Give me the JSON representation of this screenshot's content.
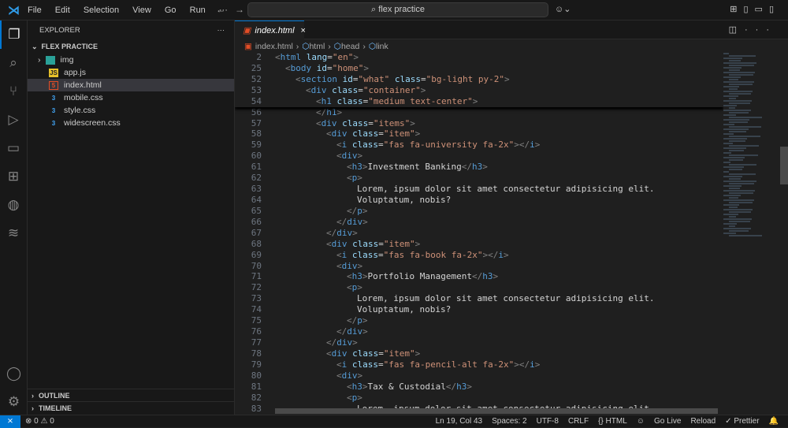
{
  "titlebar": {
    "menu": [
      "File",
      "Edit",
      "Selection",
      "View",
      "Go",
      "Run",
      "···"
    ],
    "search": "⌕ flex practice"
  },
  "sidebar": {
    "title": "EXPLORER",
    "more": "···",
    "folder": "FLEX PRACTICE",
    "files": [
      {
        "name": "img",
        "type": "folder",
        "icon": "image-folder-icon"
      },
      {
        "name": "app.js",
        "type": "js",
        "icon": "js-file-icon"
      },
      {
        "name": "index.html",
        "type": "html",
        "icon": "html-file-icon",
        "selected": true
      },
      {
        "name": "mobile.css",
        "type": "css",
        "icon": "css-file-icon"
      },
      {
        "name": "style.css",
        "type": "css",
        "icon": "css-file-icon"
      },
      {
        "name": "widescreen.css",
        "type": "css",
        "icon": "css-file-icon"
      }
    ],
    "outline": "OUTLINE",
    "timeline": "TIMELINE"
  },
  "tab": {
    "label": "index.html",
    "close": "×"
  },
  "breadcrumbs": [
    "index.html",
    "html",
    "head",
    "link"
  ],
  "sticky": [
    {
      "n": 2,
      "i": 0,
      "tk": [
        [
          "p",
          "<"
        ],
        [
          "t",
          "html"
        ],
        [
          "x",
          " "
        ],
        [
          "a",
          "lang"
        ],
        [
          "x",
          "="
        ],
        [
          "s",
          "\"en\""
        ],
        [
          "p",
          ">"
        ]
      ]
    },
    {
      "n": 25,
      "i": 1,
      "tk": [
        [
          "p",
          "<"
        ],
        [
          "t",
          "body"
        ],
        [
          "x",
          " "
        ],
        [
          "a",
          "id"
        ],
        [
          "x",
          "="
        ],
        [
          "s",
          "\"home\""
        ],
        [
          "p",
          ">"
        ]
      ]
    },
    {
      "n": 52,
      "i": 2,
      "tk": [
        [
          "p",
          "<"
        ],
        [
          "t",
          "section"
        ],
        [
          "x",
          " "
        ],
        [
          "a",
          "id"
        ],
        [
          "x",
          "="
        ],
        [
          "s",
          "\"what\""
        ],
        [
          "x",
          " "
        ],
        [
          "a",
          "class"
        ],
        [
          "x",
          "="
        ],
        [
          "s",
          "\"bg-light py-2\""
        ],
        [
          "p",
          ">"
        ]
      ]
    },
    {
      "n": 53,
      "i": 3,
      "tk": [
        [
          "p",
          "<"
        ],
        [
          "t",
          "div"
        ],
        [
          "x",
          " "
        ],
        [
          "a",
          "class"
        ],
        [
          "x",
          "="
        ],
        [
          "s",
          "\"container\""
        ],
        [
          "p",
          ">"
        ]
      ]
    },
    {
      "n": 54,
      "i": 4,
      "tk": [
        [
          "p",
          "<"
        ],
        [
          "t",
          "h1"
        ],
        [
          "x",
          " "
        ],
        [
          "a",
          "class"
        ],
        [
          "x",
          "="
        ],
        [
          "s",
          "\"medium text-center\""
        ],
        [
          "p",
          ">"
        ]
      ]
    }
  ],
  "lines": [
    {
      "n": 56,
      "i": 4,
      "tk": [
        [
          "p",
          "</"
        ],
        [
          "t",
          "h1"
        ],
        [
          "p",
          ">"
        ]
      ]
    },
    {
      "n": 57,
      "i": 4,
      "tk": [
        [
          "p",
          "<"
        ],
        [
          "t",
          "div"
        ],
        [
          "x",
          " "
        ],
        [
          "a",
          "class"
        ],
        [
          "x",
          "="
        ],
        [
          "s",
          "\"items\""
        ],
        [
          "p",
          ">"
        ]
      ]
    },
    {
      "n": 58,
      "i": 5,
      "tk": [
        [
          "p",
          "<"
        ],
        [
          "t",
          "div"
        ],
        [
          "x",
          " "
        ],
        [
          "a",
          "class"
        ],
        [
          "x",
          "="
        ],
        [
          "s",
          "\"item\""
        ],
        [
          "p",
          ">"
        ]
      ]
    },
    {
      "n": 59,
      "i": 6,
      "tk": [
        [
          "p",
          "<"
        ],
        [
          "t",
          "i"
        ],
        [
          "x",
          " "
        ],
        [
          "a",
          "class"
        ],
        [
          "x",
          "="
        ],
        [
          "s",
          "\"fas fa-university fa-2x\""
        ],
        [
          "p",
          "></"
        ],
        [
          "t",
          "i"
        ],
        [
          "p",
          ">"
        ]
      ]
    },
    {
      "n": 60,
      "i": 6,
      "tk": [
        [
          "p",
          "<"
        ],
        [
          "t",
          "div"
        ],
        [
          "p",
          ">"
        ]
      ]
    },
    {
      "n": 61,
      "i": 7,
      "tk": [
        [
          "p",
          "<"
        ],
        [
          "t",
          "h3"
        ],
        [
          "p",
          ">"
        ],
        [
          "x",
          "Investment Banking"
        ],
        [
          "p",
          "</"
        ],
        [
          "t",
          "h3"
        ],
        [
          "p",
          ">"
        ]
      ]
    },
    {
      "n": 62,
      "i": 7,
      "tk": [
        [
          "p",
          "<"
        ],
        [
          "t",
          "p"
        ],
        [
          "p",
          ">"
        ]
      ]
    },
    {
      "n": 63,
      "i": 8,
      "tk": [
        [
          "x",
          "Lorem, ipsum dolor sit amet consectetur adipisicing elit."
        ]
      ]
    },
    {
      "n": 64,
      "i": 8,
      "tk": [
        [
          "x",
          "Voluptatum, nobis?"
        ]
      ]
    },
    {
      "n": 65,
      "i": 7,
      "tk": [
        [
          "p",
          "</"
        ],
        [
          "t",
          "p"
        ],
        [
          "p",
          ">"
        ]
      ]
    },
    {
      "n": 66,
      "i": 6,
      "tk": [
        [
          "p",
          "</"
        ],
        [
          "t",
          "div"
        ],
        [
          "p",
          ">"
        ]
      ]
    },
    {
      "n": 67,
      "i": 5,
      "tk": [
        [
          "p",
          "</"
        ],
        [
          "t",
          "div"
        ],
        [
          "p",
          ">"
        ]
      ]
    },
    {
      "n": 68,
      "i": 5,
      "tk": [
        [
          "p",
          "<"
        ],
        [
          "t",
          "div"
        ],
        [
          "x",
          " "
        ],
        [
          "a",
          "class"
        ],
        [
          "x",
          "="
        ],
        [
          "s",
          "\"item\""
        ],
        [
          "p",
          ">"
        ]
      ]
    },
    {
      "n": 69,
      "i": 6,
      "tk": [
        [
          "p",
          "<"
        ],
        [
          "t",
          "i"
        ],
        [
          "x",
          " "
        ],
        [
          "a",
          "class"
        ],
        [
          "x",
          "="
        ],
        [
          "s",
          "\"fas fa-book fa-2x\""
        ],
        [
          "p",
          "></"
        ],
        [
          "t",
          "i"
        ],
        [
          "p",
          ">"
        ]
      ]
    },
    {
      "n": 70,
      "i": 6,
      "tk": [
        [
          "p",
          "<"
        ],
        [
          "t",
          "div"
        ],
        [
          "p",
          ">"
        ]
      ]
    },
    {
      "n": 71,
      "i": 7,
      "tk": [
        [
          "p",
          "<"
        ],
        [
          "t",
          "h3"
        ],
        [
          "p",
          ">"
        ],
        [
          "x",
          "Portfolio Management"
        ],
        [
          "p",
          "</"
        ],
        [
          "t",
          "h3"
        ],
        [
          "p",
          ">"
        ]
      ]
    },
    {
      "n": 72,
      "i": 7,
      "tk": [
        [
          "p",
          "<"
        ],
        [
          "t",
          "p"
        ],
        [
          "p",
          ">"
        ]
      ]
    },
    {
      "n": 73,
      "i": 8,
      "tk": [
        [
          "x",
          "Lorem, ipsum dolor sit amet consectetur adipisicing elit."
        ]
      ]
    },
    {
      "n": 74,
      "i": 8,
      "tk": [
        [
          "x",
          "Voluptatum, nobis?"
        ]
      ]
    },
    {
      "n": 75,
      "i": 7,
      "tk": [
        [
          "p",
          "</"
        ],
        [
          "t",
          "p"
        ],
        [
          "p",
          ">"
        ]
      ]
    },
    {
      "n": 76,
      "i": 6,
      "tk": [
        [
          "p",
          "</"
        ],
        [
          "t",
          "div"
        ],
        [
          "p",
          ">"
        ]
      ]
    },
    {
      "n": 77,
      "i": 5,
      "tk": [
        [
          "p",
          "</"
        ],
        [
          "t",
          "div"
        ],
        [
          "p",
          ">"
        ]
      ]
    },
    {
      "n": 78,
      "i": 5,
      "tk": [
        [
          "p",
          "<"
        ],
        [
          "t",
          "div"
        ],
        [
          "x",
          " "
        ],
        [
          "a",
          "class"
        ],
        [
          "x",
          "="
        ],
        [
          "s",
          "\"item\""
        ],
        [
          "p",
          ">"
        ]
      ]
    },
    {
      "n": 79,
      "i": 6,
      "tk": [
        [
          "p",
          "<"
        ],
        [
          "t",
          "i"
        ],
        [
          "x",
          " "
        ],
        [
          "a",
          "class"
        ],
        [
          "x",
          "="
        ],
        [
          "s",
          "\"fas fa-pencil-alt fa-2x\""
        ],
        [
          "p",
          "></"
        ],
        [
          "t",
          "i"
        ],
        [
          "p",
          ">"
        ]
      ]
    },
    {
      "n": 80,
      "i": 6,
      "tk": [
        [
          "p",
          "<"
        ],
        [
          "t",
          "div"
        ],
        [
          "p",
          ">"
        ]
      ]
    },
    {
      "n": 81,
      "i": 7,
      "tk": [
        [
          "p",
          "<"
        ],
        [
          "t",
          "h3"
        ],
        [
          "p",
          ">"
        ],
        [
          "x",
          "Tax & Custodial"
        ],
        [
          "p",
          "</"
        ],
        [
          "t",
          "h3"
        ],
        [
          "p",
          ">"
        ]
      ]
    },
    {
      "n": 82,
      "i": 7,
      "tk": [
        [
          "p",
          "<"
        ],
        [
          "t",
          "p"
        ],
        [
          "p",
          ">"
        ]
      ]
    },
    {
      "n": 83,
      "i": 8,
      "tk": [
        [
          "x",
          "Lorem, ipsum dolor sit amet consectetur adipisicing elit."
        ]
      ]
    }
  ],
  "status": {
    "remote": "⨯",
    "problems": "⊗ 0 ⚠ 0",
    "items": [
      "Ln 19, Col 43",
      "Spaces: 2",
      "UTF-8",
      "CRLF",
      "{} HTML",
      "Go Live",
      "Reload",
      "✓ Prettier",
      "🔔"
    ]
  },
  "colors": {
    "accent": "#0078d4",
    "tag": "#569cd6",
    "attr": "#9cdcfe",
    "string": "#ce9178"
  }
}
